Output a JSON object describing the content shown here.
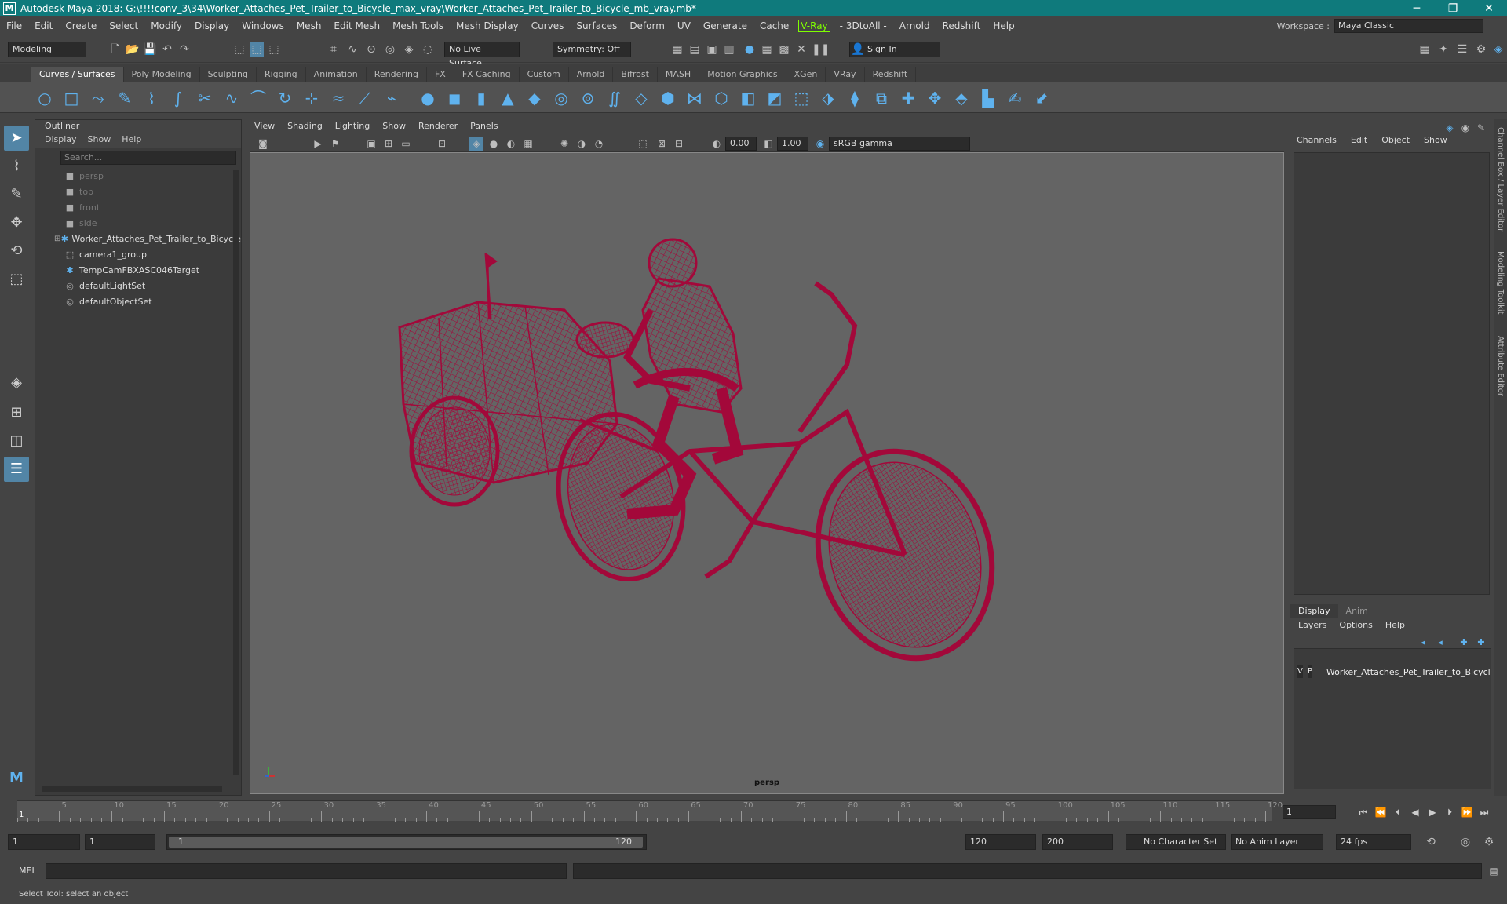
{
  "window": {
    "title": "Autodesk Maya 2018: G:\\!!!!conv_3\\34\\Worker_Attaches_Pet_Trailer_to_Bicycle_max_vray\\Worker_Attaches_Pet_Trailer_to_Bicycle_mb_vray.mb*",
    "logo_letter": "M",
    "minimize": "─",
    "restore": "❐",
    "close": "✕"
  },
  "menubar": {
    "items": [
      "File",
      "Edit",
      "Create",
      "Select",
      "Modify",
      "Display",
      "Windows",
      "Mesh",
      "Edit Mesh",
      "Mesh Tools",
      "Mesh Display",
      "Curves",
      "Surfaces",
      "Deform",
      "UV",
      "Generate",
      "Cache"
    ],
    "vray": "V-Ray",
    "items_after": [
      "- 3DtoAll -",
      "Arnold",
      "Redshift",
      "Help"
    ],
    "workspace_label": "Workspace :",
    "workspace_value": "Maya Classic"
  },
  "statusline": {
    "mode": "Modeling",
    "live_surface": "No Live Surface",
    "symmetry": "Symmetry: Off",
    "sign_in": "Sign In"
  },
  "shelf": {
    "tabs": [
      "Curves / Surfaces",
      "Poly Modeling",
      "Sculpting",
      "Rigging",
      "Animation",
      "Rendering",
      "FX",
      "FX Caching",
      "Custom",
      "Arnold",
      "Bifrost",
      "MASH",
      "Motion Graphics",
      "XGen",
      "VRay",
      "Redshift"
    ],
    "active_tab": 0
  },
  "outliner": {
    "title": "Outliner",
    "menu": [
      "Display",
      "Show",
      "Help"
    ],
    "search_placeholder": "Search...",
    "items": [
      {
        "label": "persp",
        "icon": "camera-icon",
        "dim": true
      },
      {
        "label": "top",
        "icon": "camera-icon",
        "dim": true
      },
      {
        "label": "front",
        "icon": "camera-icon",
        "dim": true
      },
      {
        "label": "side",
        "icon": "camera-icon",
        "dim": true
      },
      {
        "label": "Worker_Attaches_Pet_Trailer_to_Bicycle",
        "icon": "transform-icon",
        "dim": false,
        "expandable": true
      },
      {
        "label": "camera1_group",
        "icon": "group-icon",
        "dim": false
      },
      {
        "label": "TempCamFBXASC046Target",
        "icon": "transform-icon",
        "dim": false
      },
      {
        "label": "defaultLightSet",
        "icon": "set-icon",
        "dim": false
      },
      {
        "label": "defaultObjectSet",
        "icon": "set-icon",
        "dim": false
      }
    ]
  },
  "viewport": {
    "menu": [
      "View",
      "Shading",
      "Lighting",
      "Show",
      "Renderer",
      "Panels"
    ],
    "exposure": "0.00",
    "gamma": "1.00",
    "colorspace": "sRGB gamma",
    "camera": "persp",
    "wire_color": "#a3083a"
  },
  "channelbox": {
    "tabs": [
      "Channels",
      "Edit",
      "Object",
      "Show"
    ],
    "side_labels": [
      "Channel Box / Layer Editor",
      "Modeling Toolkit",
      "Attribute Editor"
    ]
  },
  "layereditor": {
    "tabs": [
      "Display",
      "Anim"
    ],
    "menu": [
      "Layers",
      "Options",
      "Help"
    ],
    "layer": {
      "v": "V",
      "p": "P",
      "name": "Worker_Attaches_Pet_Trailer_to_Bicycle",
      "color": "#a3083a"
    }
  },
  "timeline": {
    "ticks": [
      "5",
      "10",
      "15",
      "20",
      "25",
      "30",
      "35",
      "40",
      "45",
      "50",
      "55",
      "60",
      "65",
      "70",
      "75",
      "80",
      "85",
      "90",
      "95",
      "100",
      "105",
      "110",
      "115",
      "120"
    ],
    "first_label": "1",
    "current_frame": "1"
  },
  "range": {
    "start": "1",
    "playback_start": "1",
    "bar_start": "1",
    "bar_end": "120",
    "playback_end": "120",
    "end": "200",
    "character_set": "No Character Set",
    "anim_layer": "No Anim Layer",
    "fps": "24 fps"
  },
  "cmdline": {
    "label": "MEL"
  },
  "helpline": {
    "text": "Select Tool: select an object"
  }
}
